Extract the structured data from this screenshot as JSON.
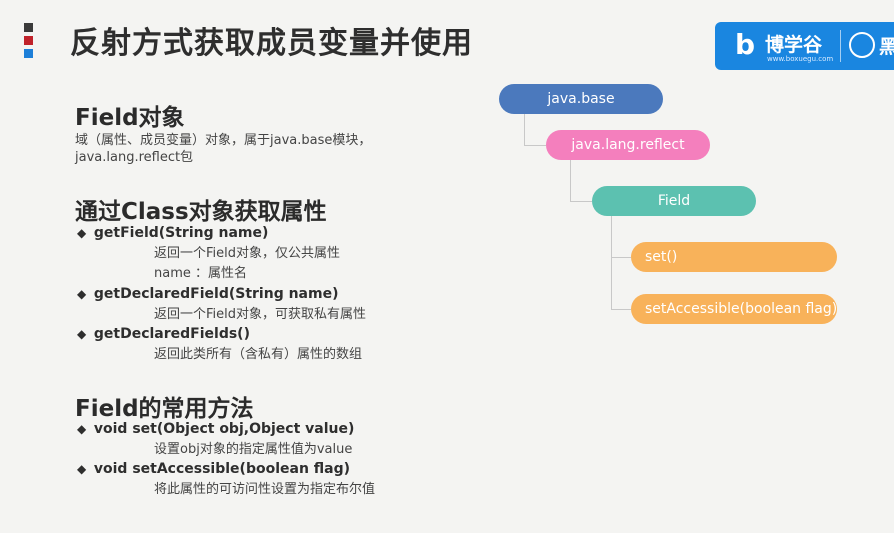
{
  "header": {
    "title": "反射方式获取成员变量并使用"
  },
  "logo": {
    "brand_name": "博学谷",
    "brand_url": "www.boxuegu.com",
    "partner_name": "黑"
  },
  "section_field": {
    "heading": "Field对象",
    "line1": "域（属性、成员变量）对象，属于java.base模块，",
    "line2": "java.lang.reflect包"
  },
  "section_class": {
    "heading": "通过Class对象获取属性",
    "items": [
      {
        "signature": "getField(String name)",
        "desc1": "返回一个Field对象，仅公共属性",
        "desc2": "name ：属性名"
      },
      {
        "signature": "getDeclaredField(String name)",
        "desc1": "返回一个Field对象，可获取私有属性"
      },
      {
        "signature": "getDeclaredFields()",
        "desc1": "返回此类所有（含私有）属性的数组"
      }
    ]
  },
  "section_methods": {
    "heading": "Field的常用方法",
    "items": [
      {
        "signature": "void set(Object obj,Object value)",
        "desc1": "设置obj对象的指定属性值为value"
      },
      {
        "signature": "void setAccessible(boolean flag)",
        "desc1": "将此属性的可访问性设置为指定布尔值"
      }
    ]
  },
  "bullet_symbol": "◆",
  "tree": {
    "module": "java.base",
    "package": "java.lang.reflect",
    "class": "Field",
    "method1": "set()",
    "method2": "setAccessible(boolean flag)"
  },
  "colors": {
    "module": "#4b79bd",
    "package": "#f47fbd",
    "class": "#5cc1b0",
    "method": "#f8b25a",
    "logo": "#1a86e0"
  }
}
